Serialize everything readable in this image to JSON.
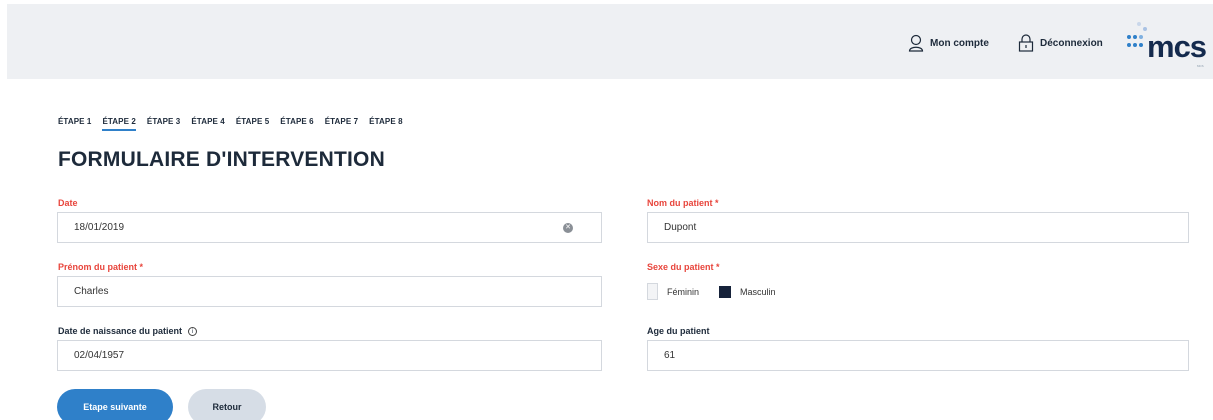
{
  "header": {
    "account_label": "Mon compte",
    "logout_label": "Déconnexion",
    "logo_text": "mcs",
    "logo_subtext": "MCS"
  },
  "steps": [
    "ÉTAPE 1",
    "ÉTAPE 2",
    "ÉTAPE 3",
    "ÉTAPE 4",
    "ÉTAPE 5",
    "ÉTAPE 6",
    "ÉTAPE 7",
    "ÉTAPE 8"
  ],
  "active_step_index": 1,
  "form": {
    "title": "FORMULAIRE D'INTERVENTION",
    "date": {
      "label": "Date",
      "value": "18/01/2019"
    },
    "patient_name": {
      "label": "Nom du patient *",
      "value": "Dupont"
    },
    "first_name": {
      "label": "Prénom du patient *",
      "value": "Charles"
    },
    "sex": {
      "label": "Sexe du patient *",
      "options": [
        "Féminin",
        "Masculin"
      ],
      "selected": "Masculin"
    },
    "birth_date": {
      "label": "Date de naissance du patient",
      "value": "02/04/1957"
    },
    "age": {
      "label": "Age du patient",
      "value": "61"
    }
  },
  "buttons": {
    "next": "Etape suivante",
    "back": "Retour"
  },
  "colors": {
    "accent": "#2f80c9",
    "required": "#e8453c",
    "dark": "#1d2a3a"
  }
}
